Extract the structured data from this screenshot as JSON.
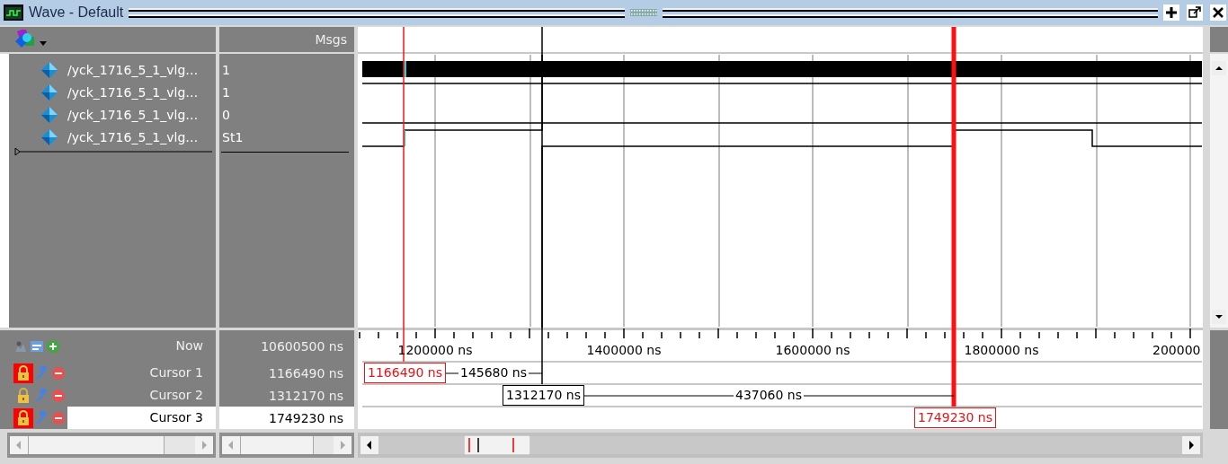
{
  "window": {
    "title": "Wave - Default"
  },
  "header": {
    "column_2": "Msgs"
  },
  "signals": [
    {
      "name": "/yck_1716_5_1_vlg…",
      "value": "1"
    },
    {
      "name": "/yck_1716_5_1_vlg…",
      "value": "1"
    },
    {
      "name": "/yck_1716_5_1_vlg…",
      "value": "0"
    },
    {
      "name": "/yck_1716_5_1_vlg…",
      "value": "St1"
    }
  ],
  "now": {
    "label": "Now",
    "value": "10600500 ns"
  },
  "cursors": [
    {
      "label": "Cursor 1",
      "value": "1166490 ns",
      "locked": true,
      "selected": false,
      "marker": "1166490 ns",
      "delta": "145680 ns"
    },
    {
      "label": "Cursor 2",
      "value": "1312170 ns",
      "locked": false,
      "selected": false,
      "marker": "1312170 ns",
      "delta": "437060 ns"
    },
    {
      "label": "Cursor 3",
      "value": "1749230 ns",
      "locked": true,
      "selected": true,
      "marker": "1749230 ns"
    }
  ],
  "ruler": {
    "labels": [
      "1200000 ns",
      "1400000 ns",
      "1600000 ns",
      "1800000 ns",
      "200000"
    ]
  }
}
